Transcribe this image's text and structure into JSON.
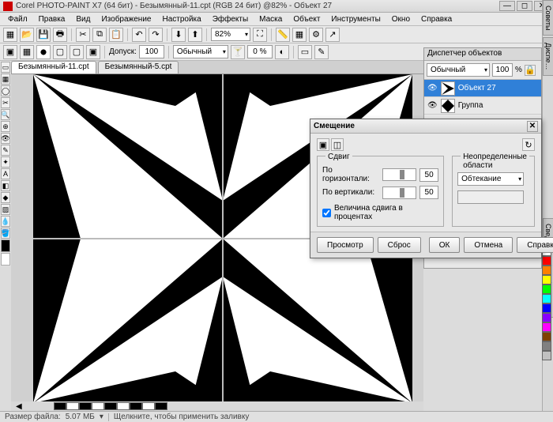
{
  "title": "Corel PHOTO-PAINT X7 (64 бит) - Безымянный-11.cpt (RGB 24 бит) @82% - Объект 27",
  "menu": [
    "Файл",
    "Правка",
    "Вид",
    "Изображение",
    "Настройка",
    "Эффекты",
    "Маска",
    "Объект",
    "Инструменты",
    "Окно",
    "Справка"
  ],
  "toolbar1": {
    "zoom": "82%"
  },
  "propbar": {
    "label_dopusk": "Допуск:",
    "dopusk": "100",
    "mode": "Обычный",
    "opacity": "0 %"
  },
  "tabs": [
    {
      "name": "Безымянный-11.cpt"
    },
    {
      "name": "Безымянный-5.cpt"
    }
  ],
  "objects_panel": {
    "title": "Диспетчер объектов",
    "blend": "Обычный",
    "opacity": "100",
    "pctsym": "%",
    "layers": [
      {
        "name": "Объект 27",
        "selected": true
      },
      {
        "name": "Группа",
        "selected": false
      }
    ]
  },
  "dialog": {
    "title": "Смещение",
    "group_shift": "Сдвиг",
    "h_label": "По горизонтали:",
    "h_val": "50",
    "v_label": "По вертикали:",
    "v_val": "50",
    "check_pct": "Величина сдвига в процентах",
    "group_undef": "Неопределенные области",
    "wrap": "Обтекание",
    "btn_preview": "Просмотр",
    "btn_reset": "Сброс",
    "btn_ok": "ОК",
    "btn_cancel": "Отмена",
    "btn_help": "Справка"
  },
  "status": {
    "size_label": "Размер файла:",
    "size": "5.07 МБ",
    "hint": "Щелкните, чтобы применить заливку"
  },
  "side_tabs": [
    "Советы",
    "Диспе…",
    "Сведения об изображении"
  ],
  "swatches": [
    "#000",
    "#fff",
    "#f00",
    "#ff8000",
    "#ff0",
    "#0f0",
    "#0ff",
    "#00f",
    "#80f",
    "#f0f",
    "#804000",
    "#808080",
    "#c0c0c0",
    "#400000",
    "#004000"
  ]
}
